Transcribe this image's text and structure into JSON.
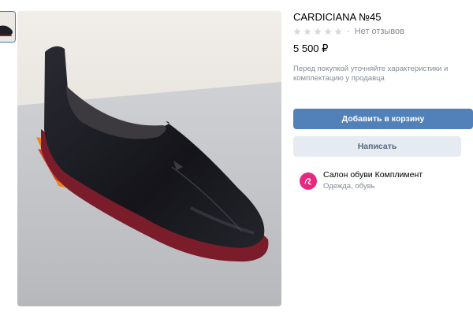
{
  "product": {
    "title": "CARDICIANA №45",
    "reviews_text": "Нет отзывов",
    "rating_separator": "·",
    "stars_filled": 0,
    "stars_total": 5,
    "price": "5 500 ₽",
    "hint": "Перед покупкой уточняйте характеристики и комплектацию у продавца"
  },
  "actions": {
    "add_to_cart_label": "Добавить в корзину",
    "write_label": "Написать"
  },
  "seller": {
    "name": "Салон обуви Комплимент",
    "category": "Одежда, обувь"
  },
  "colors": {
    "primary_button": "#5181b8",
    "secondary_button": "#e5ebf1",
    "muted_text": "#818c99",
    "seller_avatar": "#e6297e"
  },
  "icons": {
    "rating": "star-icon",
    "seller_avatar": "shop-logo-icon"
  }
}
